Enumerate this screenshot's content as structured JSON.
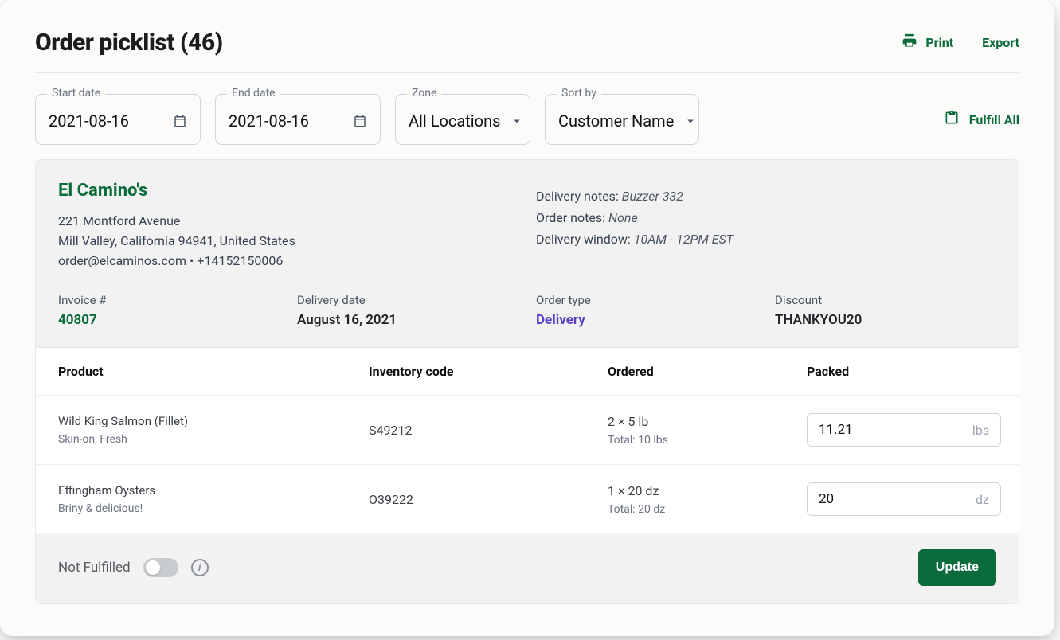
{
  "header": {
    "title": "Order picklist (46)",
    "print_label": "Print",
    "export_label": "Export"
  },
  "filters": {
    "start_date_label": "Start date",
    "start_date_value": "2021-08-16",
    "end_date_label": "End date",
    "end_date_value": "2021-08-16",
    "zone_label": "Zone",
    "zone_value": "All Locations",
    "sort_label": "Sort by",
    "sort_value": "Customer Name",
    "fulfill_all_label": "Fulfill All"
  },
  "order": {
    "customer_name": "El Camino's",
    "address_line1": "221 Montford Avenue",
    "address_line2": "Mill Valley, California 94941, United States",
    "contact_line": "order@elcaminos.com • +14152150006",
    "delivery_notes_label": "Delivery notes:",
    "delivery_notes_value": "Buzzer 332",
    "order_notes_label": "Order notes:",
    "order_notes_value": "None",
    "delivery_window_label": "Delivery window:",
    "delivery_window_value": "10AM - 12PM EST",
    "invoice_label": "Invoice #",
    "invoice_value": "40807",
    "delivery_date_label": "Delivery date",
    "delivery_date_value": "August 16, 2021",
    "order_type_label": "Order type",
    "order_type_value": "Delivery",
    "discount_label": "Discount",
    "discount_value": "THANKYOU20"
  },
  "table": {
    "head": {
      "product": "Product",
      "inventory": "Inventory code",
      "ordered": "Ordered",
      "packed": "Packed"
    },
    "rows": [
      {
        "product": "Wild King Salmon (Fillet)",
        "sub": "Skin-on, Fresh",
        "code": "S49212",
        "ordered": "2 × 5 lb",
        "ordered_total": "Total: 10 lbs",
        "packed_value": "11.21",
        "packed_unit": "lbs"
      },
      {
        "product": "Effingham Oysters",
        "sub": "Briny & delicious!",
        "code": "O39222",
        "ordered": "1 × 20 dz",
        "ordered_total": "Total: 20 dz",
        "packed_value": "20",
        "packed_unit": "dz"
      }
    ]
  },
  "footer": {
    "not_fulfilled_label": "Not Fulfilled",
    "update_label": "Update"
  }
}
